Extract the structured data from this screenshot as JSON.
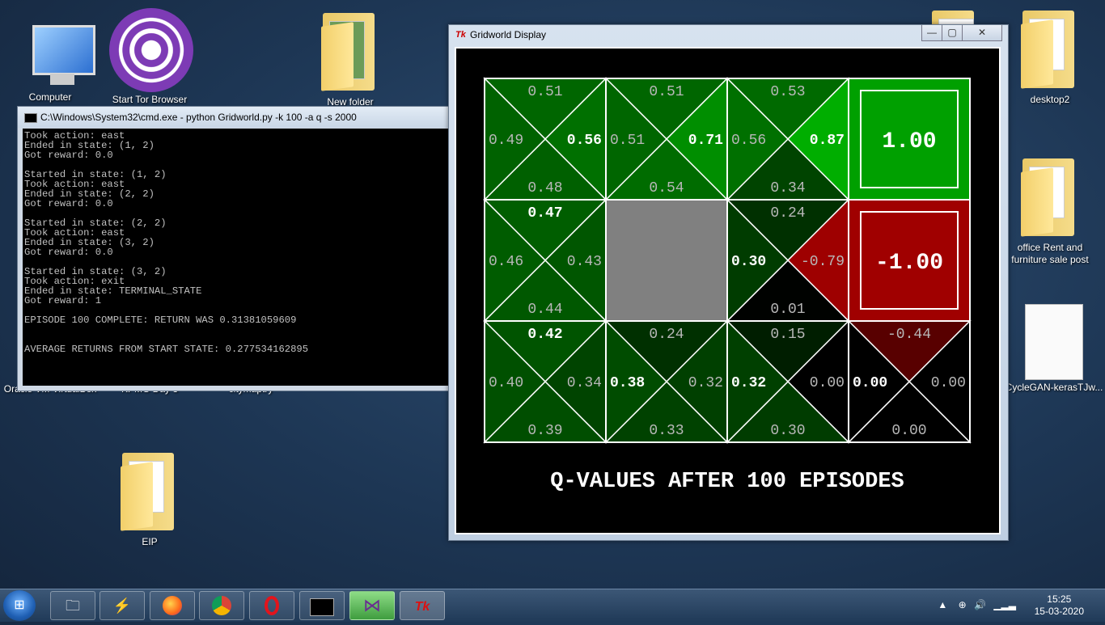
{
  "desktop": {
    "icons": [
      {
        "label": "Computer"
      },
      {
        "label": "Start Tor Browser"
      },
      {
        "label": "New folder"
      },
      {
        "label": "desktop2"
      },
      {
        "label": "office Rent and furniture sale post"
      },
      {
        "label": "CycleGAN-kerasTJw..."
      },
      {
        "label": "Oracle VM VirtualBox"
      },
      {
        "label": "KPMG Day 3"
      },
      {
        "label": "citymaptry"
      },
      {
        "label": "EIP"
      }
    ]
  },
  "cmd_window": {
    "title": "C:\\Windows\\System32\\cmd.exe - python  Gridworld.py -k 100 -a q -s 2000",
    "lines": [
      "Took action: east",
      "Ended in state: (1, 2)",
      "Got reward: 0.0",
      "",
      "Started in state: (1, 2)",
      "Took action: east",
      "Ended in state: (2, 2)",
      "Got reward: 0.0",
      "",
      "Started in state: (2, 2)",
      "Took action: east",
      "Ended in state: (3, 2)",
      "Got reward: 0.0",
      "",
      "Started in state: (3, 2)",
      "Took action: exit",
      "Ended in state: TERMINAL_STATE",
      "Got reward: 1",
      "",
      "EPISODE 100 COMPLETE: RETURN WAS 0.31381059609",
      "",
      "",
      "AVERAGE RETURNS FROM START STATE: 0.277534162895"
    ]
  },
  "gridworld_window": {
    "title": "Gridworld Display",
    "icon_text": "Tk",
    "buttons": {
      "minimize": "—",
      "maximize": "▢",
      "close": "✕"
    },
    "caption": "Q-VALUES AFTER 100 EPISODES",
    "cells": [
      {
        "row": 0,
        "col": 0,
        "type": "q",
        "n": "0.51",
        "e": "0.56",
        "s": "0.48",
        "w": "0.49"
      },
      {
        "row": 0,
        "col": 1,
        "type": "q",
        "n": "0.51",
        "e": "0.71",
        "s": "0.54",
        "w": "0.51"
      },
      {
        "row": 0,
        "col": 2,
        "type": "q",
        "n": "0.53",
        "e": "0.87",
        "s": "0.34",
        "w": "0.56"
      },
      {
        "row": 0,
        "col": 3,
        "type": "terminal",
        "value": "1.00"
      },
      {
        "row": 1,
        "col": 0,
        "type": "q",
        "n": "0.47",
        "e": "0.43",
        "s": "0.44",
        "w": "0.46"
      },
      {
        "row": 1,
        "col": 1,
        "type": "wall"
      },
      {
        "row": 1,
        "col": 2,
        "type": "q",
        "n": "0.24",
        "e": "-0.79",
        "s": "0.01",
        "w": "0.30"
      },
      {
        "row": 1,
        "col": 3,
        "type": "terminal",
        "value": "-1.00"
      },
      {
        "row": 2,
        "col": 0,
        "type": "q",
        "n": "0.42",
        "e": "0.34",
        "s": "0.39",
        "w": "0.40"
      },
      {
        "row": 2,
        "col": 1,
        "type": "q",
        "n": "0.24",
        "e": "0.32",
        "s": "0.33",
        "w": "0.38"
      },
      {
        "row": 2,
        "col": 2,
        "type": "q",
        "n": "0.15",
        "e": "0.00",
        "s": "0.30",
        "w": "0.32"
      },
      {
        "row": 2,
        "col": 3,
        "type": "q",
        "n": "-0.44",
        "e": "0.00",
        "s": "0.00",
        "w": "0.00"
      }
    ],
    "best_action": {
      "0,0": "e",
      "0,1": "e",
      "0,2": "e",
      "1,0": "n",
      "1,2": "w",
      "2,0": "n",
      "2,1": "w",
      "2,2": "w",
      "2,3": "w"
    }
  },
  "taskbar": {
    "time": "15:25",
    "date": "15-03-2020",
    "items": [
      "explorer",
      "winamp",
      "firefox",
      "chrome",
      "opera",
      "cmd",
      "visual-studio",
      "tk"
    ]
  }
}
